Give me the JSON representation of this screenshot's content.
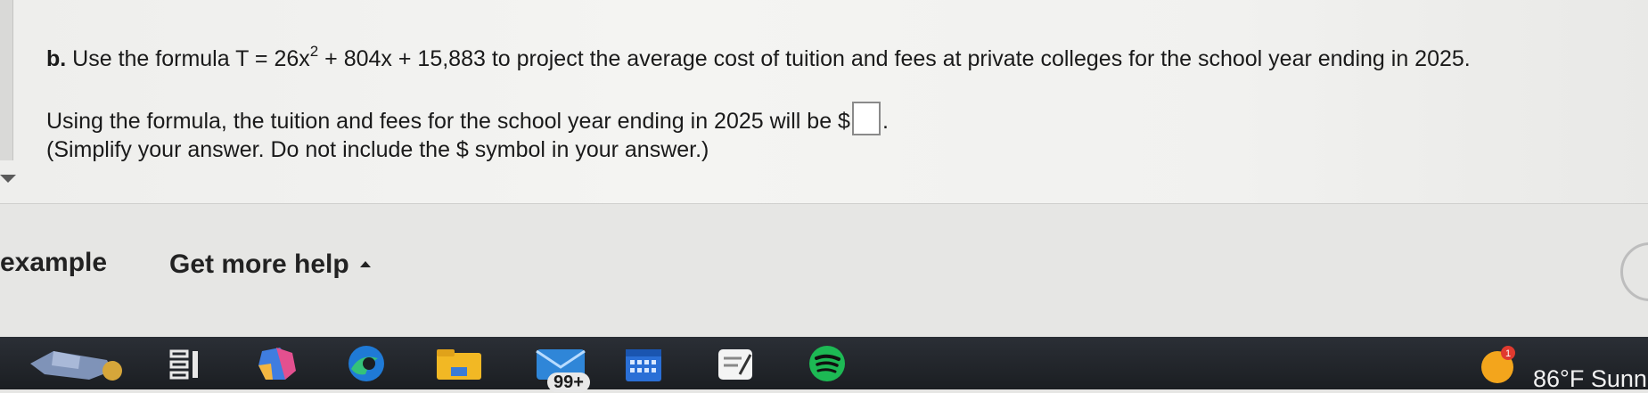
{
  "question": {
    "part_label": "b.",
    "text_before": "Use the formula T = 26x",
    "exponent": "2",
    "text_after": " + 804x + 15,883 to project the average cost of tuition and fees at private colleges for the school year ending in 2025.",
    "answer_prompt": "Using the formula, the tuition and fees for the school year ending in 2025 will be $",
    "answer_value": "",
    "answer_suffix": ".",
    "hint": "(Simplify your answer. Do not include the $ symbol in your answer.)"
  },
  "help": {
    "example_label": "example",
    "more_help_label": "Get more help"
  },
  "taskbar": {
    "mail_badge": "99+",
    "weather_text": "86°F  Sunn",
    "weather_alert": "1",
    "icons": [
      "widgets-icon",
      "task-view-icon",
      "copilot-icon",
      "edge-icon",
      "file-explorer-icon",
      "mail-icon",
      "calendar-icon",
      "notes-icon",
      "spotify-icon"
    ]
  },
  "colors": {
    "panel_bg": "#f1f1ef",
    "taskbar_bg": "#1f2227",
    "spotify": "#1db954",
    "edge_blue": "#1f7ad6",
    "folder_yellow": "#f2b824"
  }
}
